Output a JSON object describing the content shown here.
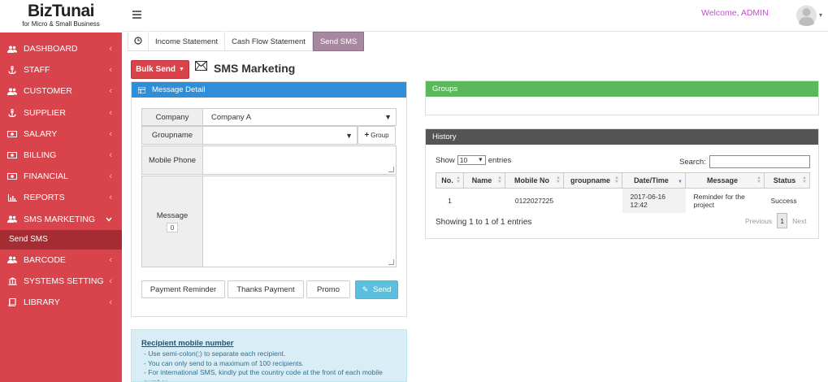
{
  "brand": {
    "name": "BizTunai",
    "tagline": "for Micro & Small Business"
  },
  "topbar": {
    "welcome": "Welcome, ADMIN"
  },
  "sidebar": {
    "items": [
      {
        "label": "DASHBOARD",
        "icon": "users-icon"
      },
      {
        "label": "STAFF",
        "icon": "anchor-icon"
      },
      {
        "label": "CUSTOMER",
        "icon": "users-icon"
      },
      {
        "label": "SUPPLIER",
        "icon": "anchor-icon"
      },
      {
        "label": "SALARY",
        "icon": "money-icon"
      },
      {
        "label": "BILLING",
        "icon": "money-icon"
      },
      {
        "label": "FINANCIAL",
        "icon": "money-icon"
      },
      {
        "label": "REPORTS",
        "icon": "bar-chart-icon"
      },
      {
        "label": "SMS MARKETING",
        "icon": "users-icon"
      },
      {
        "label": "BARCODE",
        "icon": "users-icon"
      },
      {
        "label": "SYSTEMS SETTING",
        "icon": "bank-icon"
      },
      {
        "label": "LIBRARY",
        "icon": "book-icon"
      }
    ],
    "submenu": {
      "label": "Send SMS"
    },
    "accent": "#d9434b"
  },
  "tabs": [
    "Income Statement",
    "Cash Flow Statement",
    "Send SMS"
  ],
  "toolbar": {
    "bulk_send": "Bulk Send",
    "title": "SMS Marketing"
  },
  "message_detail": {
    "title": "Message Detail",
    "company_label": "Company",
    "company_value": "Company A",
    "groupname_label": "Groupname",
    "group_button": "Group",
    "mobile_label": "Mobile Phone",
    "message_label": "Message",
    "char_count": "0",
    "templates": [
      "Payment Reminder",
      "Thanks Payment",
      "Promo"
    ],
    "send_label": "Send"
  },
  "note": {
    "title": "Recipient mobile number",
    "lines": [
      "- Use semi-colon(;) to separate each recipient.",
      "- You can only send to a maximum of 100 recipients.",
      "- For international SMS, kindly put the country code at the front of each mobile number."
    ]
  },
  "groups": {
    "title": "Groups"
  },
  "history": {
    "title": "History",
    "show_label": "Show",
    "entries_value": "10",
    "entries_label": "entries",
    "search_label": "Search:",
    "columns": [
      "No.",
      "Name",
      "Mobile No",
      "groupname",
      "Date/Time",
      "Message",
      "Status"
    ],
    "rows": [
      {
        "no": "1",
        "name": "",
        "mobile": "0122027225",
        "group": "",
        "datetime": "2017-06-16 12:42",
        "message": "Reminder for the project",
        "status": "Success"
      }
    ],
    "info": "Showing 1 to 1 of 1 entries",
    "prev": "Previous",
    "page": "1",
    "next": "Next"
  }
}
